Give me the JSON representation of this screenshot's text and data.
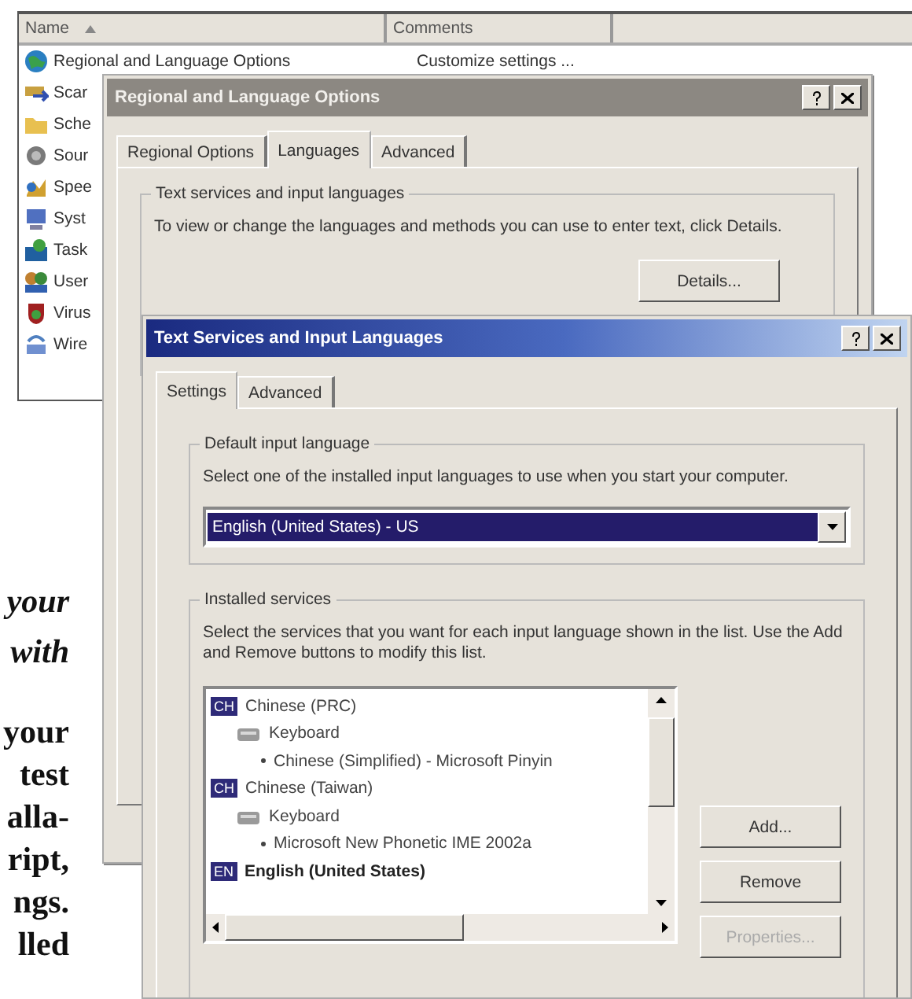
{
  "explorer": {
    "columns": [
      "Name",
      "Comments"
    ],
    "rows": [
      {
        "name": "Regional and Language Options",
        "comment": "Customize settings ..."
      },
      {
        "name": "Scar"
      },
      {
        "name": "Sche"
      },
      {
        "name": "Sour"
      },
      {
        "name": "Spee"
      },
      {
        "name": "Syst"
      },
      {
        "name": "Task"
      },
      {
        "name": "User"
      },
      {
        "name": "Virus"
      },
      {
        "name": "Wire"
      }
    ]
  },
  "regional_dialog": {
    "title": "Regional and Language Options",
    "active": false,
    "tabs": [
      {
        "label": "Regional Options",
        "selected": false
      },
      {
        "label": "Languages",
        "selected": true
      },
      {
        "label": "Advanced",
        "selected": false
      }
    ],
    "group_title": "Text services and input languages",
    "description": "To view or change the languages and methods you can use to enter text, click Details.",
    "details_button": "Details..."
  },
  "text_services_dialog": {
    "title": "Text Services and Input Languages",
    "active": true,
    "tabs": [
      {
        "label": "Settings",
        "selected": true
      },
      {
        "label": "Advanced",
        "selected": false
      }
    ],
    "default_group": {
      "title": "Default input language",
      "description": "Select one of the installed input languages to use when you start your computer.",
      "value": "English (United States) - US"
    },
    "installed_group": {
      "title": "Installed services",
      "description": "Select the services that you want for each input language shown in the list. Use the Add and Remove buttons to modify this list.",
      "items": [
        {
          "badge": "CH",
          "label": "Chinese (PRC)",
          "default": false,
          "children": [
            {
              "label": "Keyboard",
              "children": [
                {
                  "label": "Chinese (Simplified) - Microsoft Pinyin"
                }
              ]
            }
          ]
        },
        {
          "badge": "CH",
          "label": "Chinese (Taiwan)",
          "default": false,
          "children": [
            {
              "label": "Keyboard",
              "children": [
                {
                  "label": "Microsoft New Phonetic IME 2002a"
                }
              ]
            }
          ]
        },
        {
          "badge": "EN",
          "label": "English (United States)",
          "default": true
        }
      ]
    },
    "buttons": [
      {
        "label": "Add...",
        "disabled": false
      },
      {
        "label": "Remove",
        "disabled": false
      },
      {
        "label": "Properties...",
        "disabled": true
      }
    ]
  },
  "print_blocks": [
    {
      "italic": true,
      "lines": [
        "your",
        "with"
      ]
    },
    {
      "italic": false,
      "lines": [
        "your",
        "test",
        "alla-",
        "ript,",
        "ngs.",
        "lled"
      ]
    }
  ]
}
